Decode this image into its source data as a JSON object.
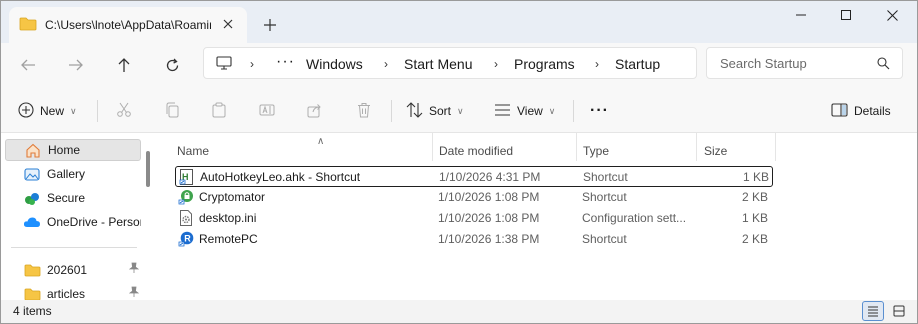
{
  "tab": {
    "title": "C:\\Users\\lnote\\AppData\\Roaming\\Microsoft"
  },
  "breadcrumbs": [
    "Windows",
    "Start Menu",
    "Programs",
    "Startup"
  ],
  "address": {
    "overflow": "···"
  },
  "search": {
    "placeholder": "Search Startup"
  },
  "toolbar": {
    "new_label": "New",
    "sort_label": "Sort",
    "view_label": "View",
    "more_label": "···",
    "details_label": "Details"
  },
  "sidebar": {
    "items": [
      {
        "label": "Home",
        "icon": "home-icon",
        "active": true
      },
      {
        "label": "Gallery",
        "icon": "gallery-icon"
      },
      {
        "label": "Secure",
        "icon": "secure-icon"
      },
      {
        "label": "OneDrive - Personal",
        "icon": "onedrive-icon"
      }
    ],
    "pinned": [
      {
        "label": "202601",
        "icon": "folder-icon"
      },
      {
        "label": "articles",
        "icon": "folder-icon"
      }
    ]
  },
  "columns": {
    "name": "Name",
    "date": "Date modified",
    "type": "Type",
    "size": "Size"
  },
  "files": [
    {
      "name": "AutoHotkeyLeo.ahk - Shortcut",
      "date": "1/10/2026 4:31 PM",
      "type": "Shortcut",
      "size": "1 KB",
      "icon": "ahk-file-icon",
      "selected": true
    },
    {
      "name": "Cryptomator",
      "date": "1/10/2026 1:08 PM",
      "type": "Shortcut",
      "size": "2 KB",
      "icon": "cryptomator-icon"
    },
    {
      "name": "desktop.ini",
      "date": "1/10/2026 1:08 PM",
      "type": "Configuration sett...",
      "size": "1 KB",
      "icon": "settings-file-icon"
    },
    {
      "name": "RemotePC",
      "date": "1/10/2026 1:38 PM",
      "type": "Shortcut",
      "size": "2 KB",
      "icon": "remotepc-icon"
    }
  ],
  "status": {
    "count": "4 items"
  },
  "colors": {
    "accent": "#0067c0",
    "folder": "#f6c545",
    "selected_view": "#5a8fd0"
  }
}
